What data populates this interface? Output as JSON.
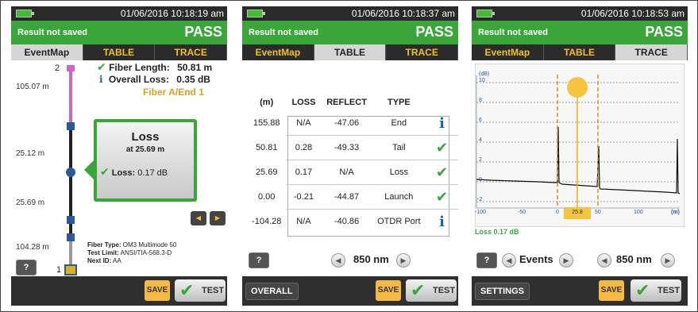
{
  "panel1": {
    "datetime": "01/06/2016 10:18:19 am",
    "result_text": "Result not saved",
    "status": "PASS",
    "tabs": [
      "EventMap",
      "TABLE",
      "TRACE"
    ],
    "fiber_length_label": "Fiber Length:",
    "fiber_length_value": "50.81 m",
    "overall_loss_label": "Overall Loss:",
    "overall_loss_value": "0.35 dB",
    "fiber_end": "Fiber A/End 1",
    "top_event_number": "2",
    "bottom_event_number": "1",
    "distances": [
      "105.07 m",
      "25.12 m",
      "25.69 m",
      "104.28 m"
    ],
    "event_box_title": "Loss",
    "event_box_position": "at 25.69 m",
    "event_box_loss_label": "Loss:",
    "event_box_loss_value": "0.17 dB",
    "fiber_type_label": "Fiber Type:",
    "fiber_type_value": "OM3 Multimode 50",
    "test_limit_label": "Test Limit:",
    "test_limit_value": "ANSI/TIA-568.3-D",
    "next_id_label": "Next ID:",
    "next_id_value": "AA",
    "help_label": "?",
    "save_label": "SAVE",
    "test_label": "TEST"
  },
  "panel2": {
    "datetime": "01/06/2016 10:18:37 am",
    "result_text": "Result not saved",
    "status": "PASS",
    "tabs": [
      "EventMap",
      "TABLE",
      "TRACE"
    ],
    "columns": [
      "(m)",
      "LOSS",
      "REFLECT",
      "TYPE"
    ],
    "rows": [
      {
        "m": "155.88",
        "loss": "N/A",
        "reflect": "-47.06",
        "type": "End",
        "icon": "info-icon"
      },
      {
        "m": "50.81",
        "loss": "0.28",
        "reflect": "-49.33",
        "type": "Tail",
        "icon": "check-icon"
      },
      {
        "m": "25.69",
        "loss": "0.17",
        "reflect": "N/A",
        "type": "Loss",
        "icon": "check-icon"
      },
      {
        "m": "0.00",
        "loss": "-0.21",
        "reflect": "-44.87",
        "type": "Launch",
        "icon": "check-icon"
      },
      {
        "m": "-104.28",
        "loss": "N/A",
        "reflect": "-40.86",
        "type": "OTDR Port",
        "icon": "info-icon"
      }
    ],
    "wavelength": "850 nm",
    "help_label": "?",
    "overall_label": "OVERALL",
    "save_label": "SAVE",
    "test_label": "TEST"
  },
  "panel3": {
    "datetime": "01/06/2016 10:18:53 am",
    "result_text": "Result not saved",
    "status": "PASS",
    "tabs": [
      "EventMap",
      "TABLE",
      "TRACE"
    ],
    "y_unit": "(dB)",
    "x_unit": "(m)",
    "y_ticks": [
      "10",
      "8",
      "6",
      "4",
      "2",
      "0",
      "-2"
    ],
    "x_ticks": [
      "-100",
      "-50",
      "0",
      "50",
      "100"
    ],
    "cursor_value": "25.8",
    "loss_readout": "Loss 0.17 dB",
    "events_label": "Events",
    "wavelength": "850 nm",
    "help_label": "?",
    "settings_label": "SETTINGS",
    "save_label": "SAVE",
    "test_label": "TEST"
  },
  "colors": {
    "pass_green": "#3aa63a",
    "tab_yellow": "#f2c21a",
    "save_orange": "#f4b942",
    "fiber_pink": "#c868c8",
    "connector_blue": "#2a5a9a",
    "cursor_orange": "#e08a1a"
  }
}
